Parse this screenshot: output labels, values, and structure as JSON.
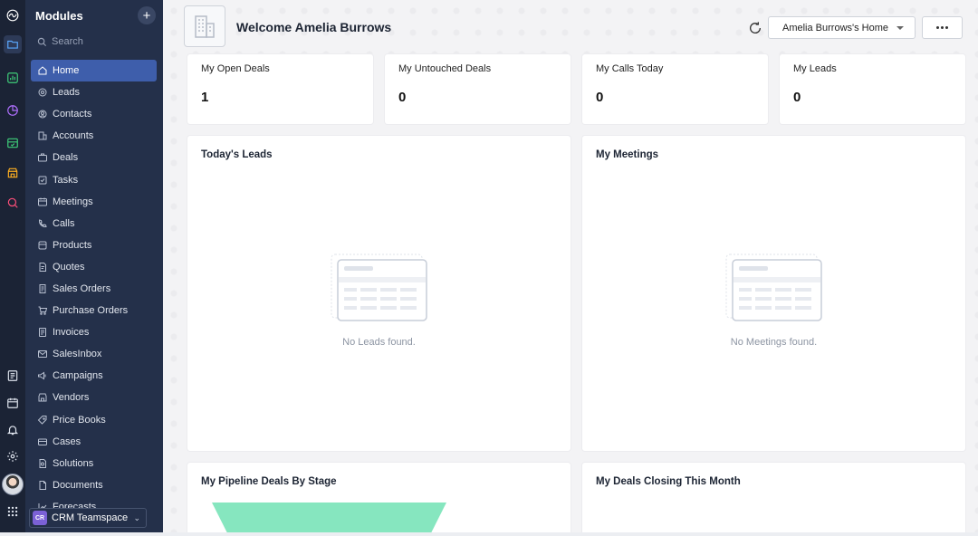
{
  "app": {
    "modules_title": "Modules",
    "search_placeholder": "Search"
  },
  "sidebar": {
    "items": [
      {
        "label": "Home",
        "icon": "home-icon",
        "active": true
      },
      {
        "label": "Leads",
        "icon": "leads-icon"
      },
      {
        "label": "Contacts",
        "icon": "contacts-icon"
      },
      {
        "label": "Accounts",
        "icon": "accounts-icon"
      },
      {
        "label": "Deals",
        "icon": "deals-icon"
      },
      {
        "label": "Tasks",
        "icon": "tasks-icon"
      },
      {
        "label": "Meetings",
        "icon": "meetings-icon"
      },
      {
        "label": "Calls",
        "icon": "calls-icon"
      },
      {
        "label": "Products",
        "icon": "products-icon"
      },
      {
        "label": "Quotes",
        "icon": "quotes-icon"
      },
      {
        "label": "Sales Orders",
        "icon": "sales-orders-icon"
      },
      {
        "label": "Purchase Orders",
        "icon": "purchase-orders-icon"
      },
      {
        "label": "Invoices",
        "icon": "invoices-icon"
      },
      {
        "label": "SalesInbox",
        "icon": "salesinbox-icon"
      },
      {
        "label": "Campaigns",
        "icon": "campaigns-icon"
      },
      {
        "label": "Vendors",
        "icon": "vendors-icon"
      },
      {
        "label": "Price Books",
        "icon": "price-books-icon"
      },
      {
        "label": "Cases",
        "icon": "cases-icon"
      },
      {
        "label": "Solutions",
        "icon": "solutions-icon"
      },
      {
        "label": "Documents",
        "icon": "documents-icon"
      },
      {
        "label": "Forecasts",
        "icon": "forecasts-icon"
      }
    ],
    "team": {
      "badge": "CR",
      "label": "CRM Teamspace"
    }
  },
  "header": {
    "welcome": "Welcome Amelia Burrows",
    "home_select": "Amelia Burrows's Home"
  },
  "stats": [
    {
      "label": "My Open Deals",
      "value": "1"
    },
    {
      "label": "My Untouched Deals",
      "value": "0"
    },
    {
      "label": "My Calls Today",
      "value": "0"
    },
    {
      "label": "My Leads",
      "value": "0"
    }
  ],
  "panels": {
    "leads": {
      "title": "Today's Leads",
      "empty": "No Leads found."
    },
    "meetings": {
      "title": "My Meetings",
      "empty": "No Meetings found."
    },
    "pipeline": {
      "title": "My Pipeline Deals By Stage"
    },
    "closing": {
      "title": "My Deals Closing This Month"
    }
  },
  "colors": {
    "sidebar": "#24304a",
    "rail": "#1b2335",
    "active": "#3e5eab",
    "funnel": "#86e6bf"
  }
}
